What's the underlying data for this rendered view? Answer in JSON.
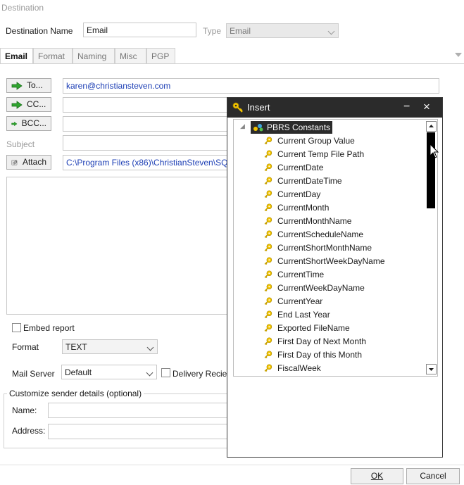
{
  "window": {
    "section_title": "Destination"
  },
  "destination": {
    "name_label": "Destination Name",
    "name_value": "Email",
    "type_label": "Type",
    "type_value": "Email"
  },
  "tabs": [
    {
      "label": "Email",
      "active": true
    },
    {
      "label": "Format",
      "active": false
    },
    {
      "label": "Naming",
      "active": false
    },
    {
      "label": "Misc",
      "active": false
    },
    {
      "label": "PGP",
      "active": false
    }
  ],
  "email": {
    "to_button": "To...",
    "to_value": "karen@christiansteven.com",
    "cc_button": "CC...",
    "cc_value": "",
    "bcc_button": "BCC...",
    "bcc_value": "",
    "subject_label": "Subject",
    "subject_value": "",
    "attach_button": "Attach",
    "attach_value": "C:\\Program Files (x86)\\ChristianSteven\\SQLRD\\",
    "embed_label": "Embed report",
    "format_label": "Format",
    "format_value": "TEXT",
    "mail_server_label": "Mail Server",
    "mail_server_value": "Default",
    "delivery_receipt_label": "Delivery Reciept"
  },
  "sender": {
    "group_title": "Customize sender details (optional)",
    "name_label": "Name:",
    "address_label": "Address:"
  },
  "footer": {
    "ok": "OK",
    "cancel": "Cancel"
  },
  "insert_popup": {
    "title": "Insert",
    "minimize": "−",
    "close": "×",
    "root": "PBRS Constants",
    "items": [
      "Current Group Value",
      "Current Temp File Path",
      "CurrentDate",
      "CurrentDateTime",
      "CurrentDay",
      "CurrentMonth",
      "CurrentMonthName",
      "CurrentScheduleName",
      "CurrentShortMonthName",
      "CurrentShortWeekDayName",
      "CurrentTime",
      "CurrentWeekDayName",
      "CurrentYear",
      "End Last Year",
      "Exported FileName",
      "First Day of Next Month",
      "First Day of this Month",
      "FiscalWeek"
    ]
  },
  "colors": {
    "link_blue": "#1d3fb5",
    "popup_title_bg": "#2b2b2b",
    "arrow_green": "#2fa52f",
    "key_yellow": "#f2c400"
  }
}
